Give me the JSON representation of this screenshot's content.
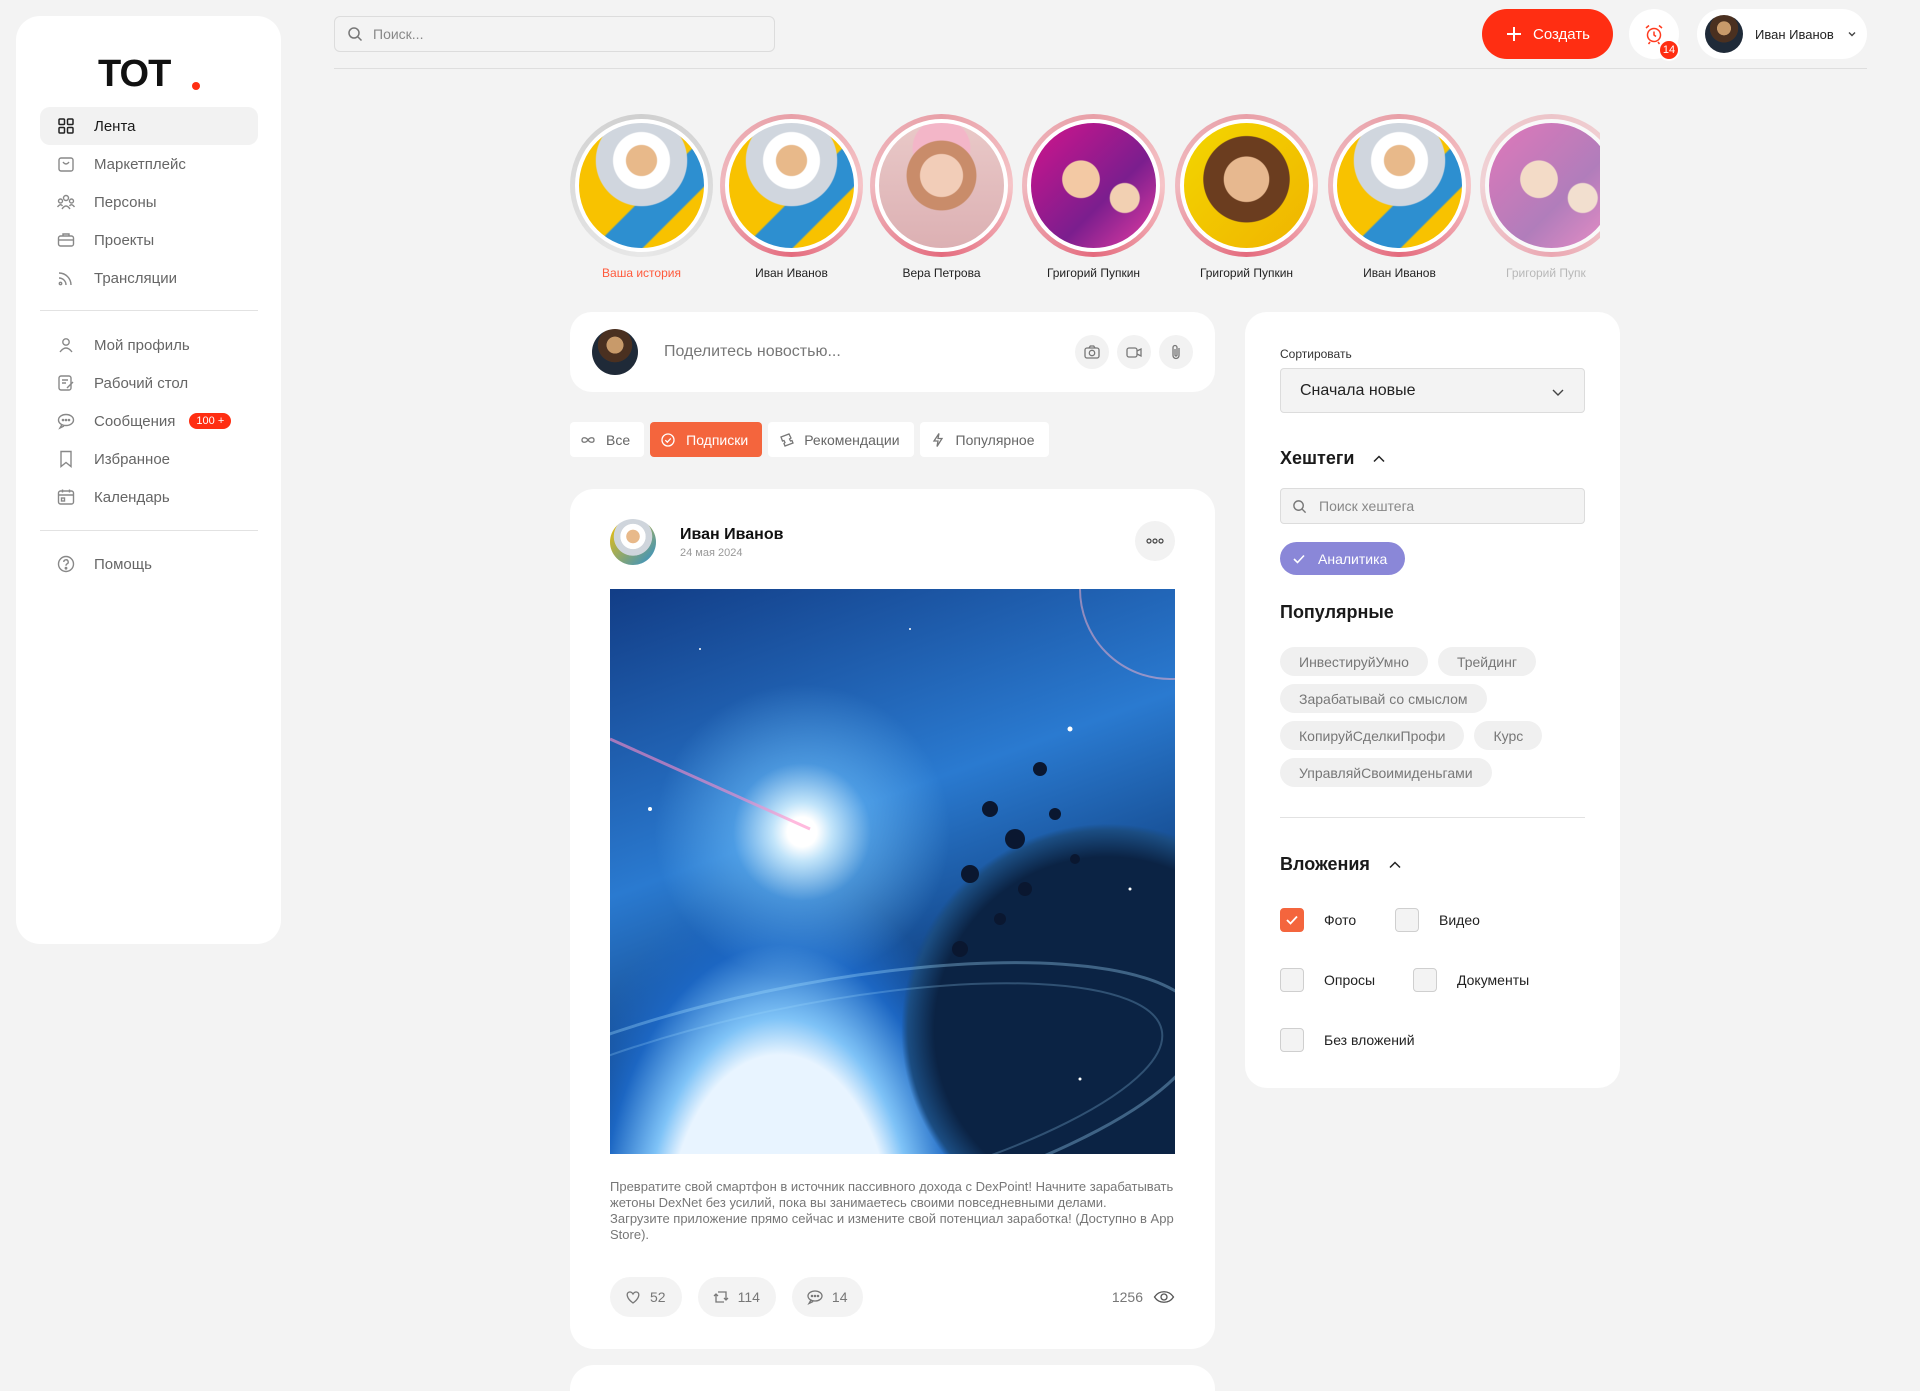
{
  "brand": {
    "logo_text": "TOT"
  },
  "sidebar": {
    "items": [
      {
        "label": "Лента",
        "icon": "grid-icon",
        "active": true
      },
      {
        "label": "Маркетплейс",
        "icon": "shop-bag-icon"
      },
      {
        "label": "Персоны",
        "icon": "people-icon"
      },
      {
        "label": "Проекты",
        "icon": "briefcase-icon"
      },
      {
        "label": "Трансляции",
        "icon": "broadcast-icon"
      },
      {
        "label": "Мой профиль",
        "icon": "user-icon"
      },
      {
        "label": "Рабочий стол",
        "icon": "edit-note-icon"
      },
      {
        "label": "Сообщения",
        "icon": "chat-icon",
        "badge": "100 +"
      },
      {
        "label": "Избранное",
        "icon": "bookmark-icon"
      },
      {
        "label": "Календарь",
        "icon": "calendar-icon"
      },
      {
        "label": "Помощь",
        "icon": "help-icon"
      }
    ]
  },
  "header": {
    "search_placeholder": "Поиск...",
    "create_label": "Создать",
    "notifications_count": "14",
    "user_name": "Иван Иванов",
    "accent": "#ff2e12"
  },
  "stories": [
    {
      "name": "Ваша история"
    },
    {
      "name": "Иван Иванов"
    },
    {
      "name": "Вера Петрова"
    },
    {
      "name": "Григорий Пупкин"
    },
    {
      "name": "Григорий Пупкин"
    },
    {
      "name": "Иван Иванов"
    },
    {
      "name": "Григорий Пупк"
    }
  ],
  "composer": {
    "placeholder": "Поделитесь новостью..."
  },
  "tabs": [
    {
      "label": "Все",
      "icon": "infinity-icon"
    },
    {
      "label": "Подписки",
      "icon": "check-circle-icon",
      "active": true
    },
    {
      "label": "Рекомендации",
      "icon": "ticket-icon"
    },
    {
      "label": "Популярное",
      "icon": "lightning-icon"
    }
  ],
  "post": {
    "author": "Иван Иванов",
    "date": "24 мая 2024",
    "text": "Превратите свой смартфон в источник пассивного дохода с DexPoint! Начните зарабатывать жетоны DexNet без усилий, пока вы занимаетесь своими повседневными делами.\nЗагрузите приложение прямо сейчас и измените свой потенциал заработка! (Доступно в App Store).",
    "likes": "52",
    "reposts": "114",
    "comments": "14",
    "views": "1256"
  },
  "filters": {
    "sort_label": "Сортировать",
    "sort_value": "Сначала новые",
    "hashtags_title": "Хештеги",
    "hashtag_search_placeholder": "Поиск хештега",
    "selected_tag": "Аналитика",
    "popular_title": "Популярные",
    "popular_tags": [
      "ИнвестируйУмно",
      "Трейдинг",
      "Зарабатывай со смыслом",
      "КопируйСделкиПрофи",
      "Курс",
      "УправляйСвоимиденьгами"
    ],
    "attachments_title": "Вложения",
    "attachments": {
      "photo": {
        "label": "Фото",
        "checked": true
      },
      "video": {
        "label": "Видео",
        "checked": false
      },
      "polls": {
        "label": "Опросы",
        "checked": false
      },
      "docs": {
        "label": "Документы",
        "checked": false
      },
      "none": {
        "label": "Без вложений",
        "checked": false
      }
    }
  }
}
